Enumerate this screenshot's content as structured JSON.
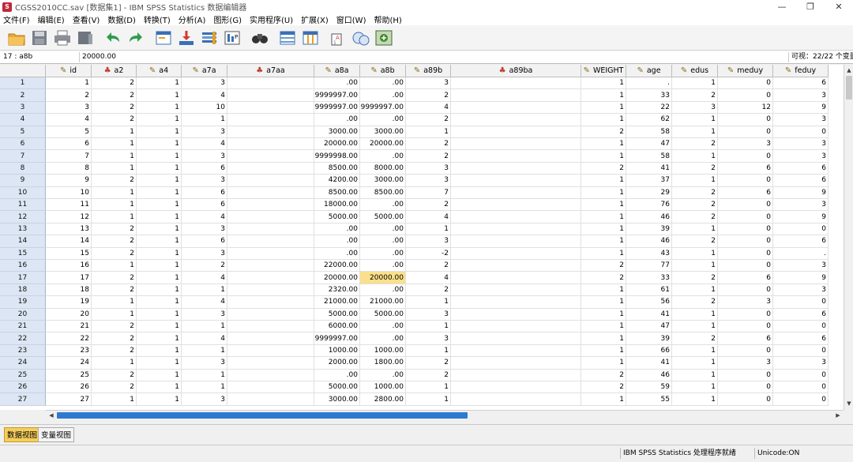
{
  "window": {
    "title": "CGSS2010CC.sav [数据集1] - IBM SPSS Statistics 数据编辑器"
  },
  "menu": [
    "文件(F)",
    "编辑(E)",
    "查看(V)",
    "数据(D)",
    "转换(T)",
    "分析(A)",
    "图形(G)",
    "实用程序(U)",
    "扩展(X)",
    "窗口(W)",
    "帮助(H)"
  ],
  "toolbar_icons": [
    "open-folder-icon",
    "save-icon",
    "print-icon",
    "dialog-recall-icon",
    "undo-icon",
    "redo-icon",
    "goto-case-icon",
    "goto-variable-icon",
    "variables-icon",
    "run-descriptives-icon",
    "find-icon",
    "split-file-icon",
    "weight-cases-icon",
    "select-cases-icon",
    "value-labels-icon",
    "use-sets-icon",
    "spelling-icon"
  ],
  "cell_ref": "17 : a8b",
  "cell_value": "20000.00",
  "visible_vars": "可视：22/22 个变量",
  "columns": [
    {
      "name": "id",
      "type": "scale"
    },
    {
      "name": "a2",
      "type": "nominal"
    },
    {
      "name": "a4",
      "type": "scale"
    },
    {
      "name": "a7a",
      "type": "scale"
    },
    {
      "name": "a7aa",
      "type": "nominal"
    },
    {
      "name": "a8a",
      "type": "scale"
    },
    {
      "name": "a8b",
      "type": "scale"
    },
    {
      "name": "a89b",
      "type": "scale"
    },
    {
      "name": "a89ba",
      "type": "nominal"
    },
    {
      "name": "WEIGHT",
      "type": "scale"
    },
    {
      "name": "age",
      "type": "scale"
    },
    {
      "name": "edus",
      "type": "scale"
    },
    {
      "name": "meduy",
      "type": "scale"
    },
    {
      "name": "feduy",
      "type": "scale"
    }
  ],
  "rows": [
    [
      "1",
      "2",
      "1",
      "3",
      "",
      ".00",
      ".00",
      "3",
      "",
      "1",
      ".",
      "1",
      "0",
      "6"
    ],
    [
      "2",
      "2",
      "1",
      "4",
      "",
      "9999997.00",
      ".00",
      "2",
      "",
      "1",
      "33",
      "2",
      "0",
      "3"
    ],
    [
      "3",
      "2",
      "1",
      "10",
      "",
      "9999997.00",
      "9999997.00",
      "4",
      "",
      "1",
      "22",
      "3",
      "12",
      "9"
    ],
    [
      "4",
      "2",
      "1",
      "1",
      "",
      ".00",
      ".00",
      "2",
      "",
      "1",
      "62",
      "1",
      "0",
      "3"
    ],
    [
      "5",
      "1",
      "1",
      "3",
      "",
      "3000.00",
      "3000.00",
      "1",
      "",
      "2",
      "58",
      "1",
      "0",
      "0"
    ],
    [
      "6",
      "1",
      "1",
      "4",
      "",
      "20000.00",
      "20000.00",
      "2",
      "",
      "1",
      "47",
      "2",
      "3",
      "3"
    ],
    [
      "7",
      "1",
      "1",
      "3",
      "",
      "9999998.00",
      ".00",
      "2",
      "",
      "1",
      "58",
      "1",
      "0",
      "3"
    ],
    [
      "8",
      "1",
      "1",
      "6",
      "",
      "8500.00",
      "8000.00",
      "3",
      "",
      "2",
      "41",
      "2",
      "6",
      "6"
    ],
    [
      "9",
      "2",
      "1",
      "3",
      "",
      "4200.00",
      "3000.00",
      "3",
      "",
      "1",
      "37",
      "1",
      "0",
      "6"
    ],
    [
      "10",
      "1",
      "1",
      "6",
      "",
      "8500.00",
      "8500.00",
      "7",
      "",
      "1",
      "29",
      "2",
      "6",
      "9"
    ],
    [
      "11",
      "1",
      "1",
      "6",
      "",
      "18000.00",
      ".00",
      "2",
      "",
      "1",
      "76",
      "2",
      "0",
      "3"
    ],
    [
      "12",
      "1",
      "1",
      "4",
      "",
      "5000.00",
      "5000.00",
      "4",
      "",
      "1",
      "46",
      "2",
      "0",
      "9"
    ],
    [
      "13",
      "2",
      "1",
      "3",
      "",
      ".00",
      ".00",
      "1",
      "",
      "1",
      "39",
      "1",
      "0",
      "0"
    ],
    [
      "14",
      "2",
      "1",
      "6",
      "",
      ".00",
      ".00",
      "3",
      "",
      "1",
      "46",
      "2",
      "0",
      "6"
    ],
    [
      "15",
      "2",
      "1",
      "3",
      "",
      ".00",
      ".00",
      "-2",
      "",
      "1",
      "43",
      "1",
      "0",
      "."
    ],
    [
      "16",
      "1",
      "1",
      "2",
      "",
      "22000.00",
      ".00",
      "2",
      "",
      "2",
      "77",
      "1",
      "0",
      "3"
    ],
    [
      "17",
      "2",
      "1",
      "4",
      "",
      "20000.00",
      "20000.00",
      "4",
      "",
      "2",
      "33",
      "2",
      "6",
      "9"
    ],
    [
      "18",
      "2",
      "1",
      "1",
      "",
      "2320.00",
      ".00",
      "2",
      "",
      "1",
      "61",
      "1",
      "0",
      "3"
    ],
    [
      "19",
      "1",
      "1",
      "4",
      "",
      "21000.00",
      "21000.00",
      "1",
      "",
      "1",
      "56",
      "2",
      "3",
      "0"
    ],
    [
      "20",
      "1",
      "1",
      "3",
      "",
      "5000.00",
      "5000.00",
      "3",
      "",
      "1",
      "41",
      "1",
      "0",
      "6"
    ],
    [
      "21",
      "2",
      "1",
      "1",
      "",
      "6000.00",
      ".00",
      "1",
      "",
      "1",
      "47",
      "1",
      "0",
      "0"
    ],
    [
      "22",
      "2",
      "1",
      "4",
      "",
      "9999997.00",
      ".00",
      "3",
      "",
      "1",
      "39",
      "2",
      "6",
      "6"
    ],
    [
      "23",
      "2",
      "1",
      "1",
      "",
      "1000.00",
      "1000.00",
      "1",
      "",
      "1",
      "66",
      "1",
      "0",
      "0"
    ],
    [
      "24",
      "1",
      "1",
      "3",
      "",
      "2000.00",
      "1800.00",
      "2",
      "",
      "1",
      "41",
      "1",
      "3",
      "3"
    ],
    [
      "25",
      "2",
      "1",
      "1",
      "",
      ".00",
      ".00",
      "2",
      "",
      "2",
      "46",
      "1",
      "0",
      "0"
    ],
    [
      "26",
      "2",
      "1",
      "1",
      "",
      "5000.00",
      "1000.00",
      "1",
      "",
      "2",
      "59",
      "1",
      "0",
      "0"
    ],
    [
      "27",
      "1",
      "1",
      "3",
      "",
      "3000.00",
      "2800.00",
      "1",
      "",
      "1",
      "55",
      "1",
      "0",
      "0"
    ]
  ],
  "tabs": {
    "data_view": "数据视图",
    "variable_view": "变量视图"
  },
  "status": {
    "processor": "IBM SPSS Statistics 处理程序就绪",
    "unicode": "Unicode:ON"
  }
}
